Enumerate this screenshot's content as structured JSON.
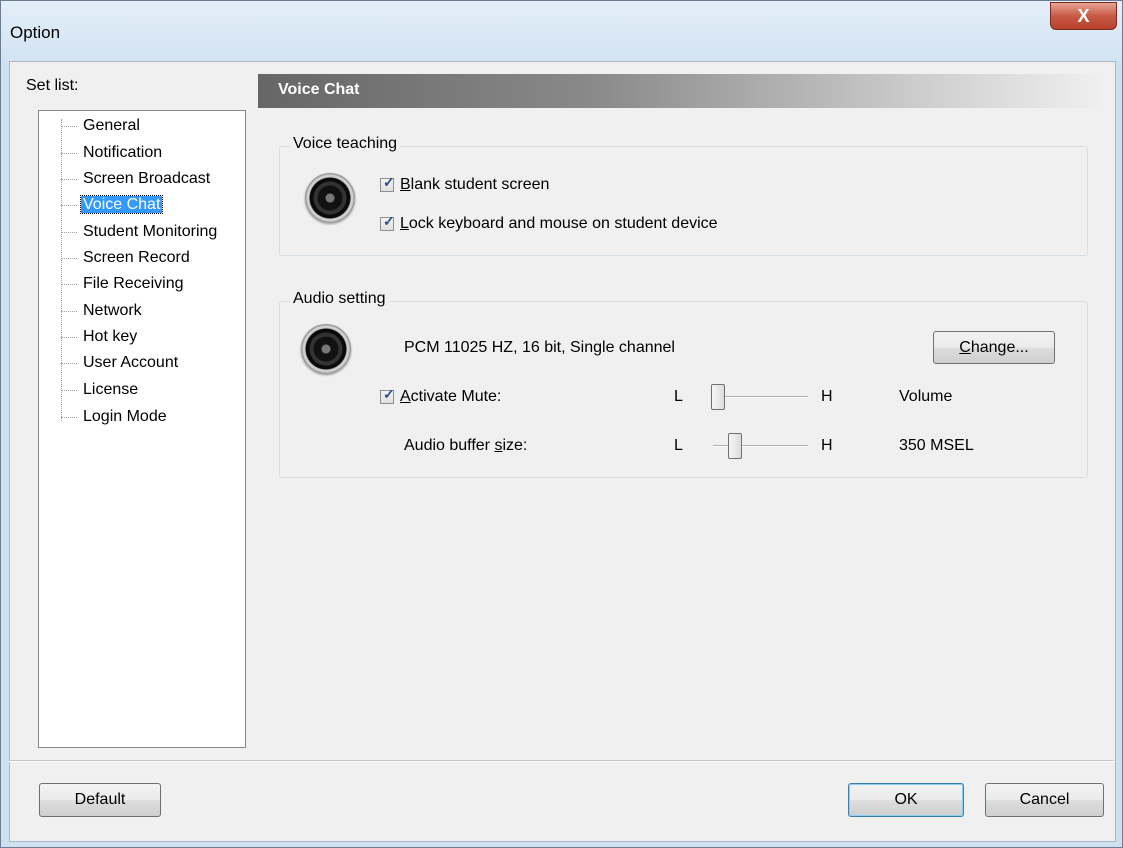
{
  "window": {
    "title": "Option",
    "close_label": "X"
  },
  "sidebar": {
    "label": "Set list:",
    "items": [
      {
        "label": "General"
      },
      {
        "label": "Notification"
      },
      {
        "label": "Screen Broadcast"
      },
      {
        "label": "Voice Chat",
        "selected": true
      },
      {
        "label": "Student Monitoring"
      },
      {
        "label": "Screen Record"
      },
      {
        "label": "File Receiving"
      },
      {
        "label": "Network"
      },
      {
        "label": "Hot key"
      },
      {
        "label": "User Account"
      },
      {
        "label": "License"
      },
      {
        "label": "Login Mode"
      }
    ]
  },
  "panel": {
    "title": "Voice Chat",
    "voice_teaching": {
      "title": "Voice teaching",
      "blank_screen": {
        "label_first": "B",
        "label_rest": "lank student screen",
        "checked": true
      },
      "lock_input": {
        "label_first": "L",
        "label_rest": "ock keyboard and mouse on student device",
        "checked": true
      }
    },
    "audio_setting": {
      "title": "Audio setting",
      "format": "PCM 11025 HZ, 16 bit, Single channel",
      "change_button": {
        "label_first": "C",
        "label_rest": "hange..."
      },
      "activate_mute": {
        "label_first": "A",
        "label_rest": "ctivate Mute:",
        "checked": true
      },
      "volume": {
        "low": "L",
        "high": "H",
        "value_label": "Volume",
        "level": 0.0
      },
      "buffer": {
        "label_pre": "Audio buffer ",
        "label_u": "s",
        "label_post": "ize:",
        "low": "L",
        "high": "H",
        "value_label": "350 MSEL",
        "level": 0.2
      }
    }
  },
  "footer": {
    "default_label": "Default",
    "ok_label": "OK",
    "cancel_label": "Cancel"
  }
}
